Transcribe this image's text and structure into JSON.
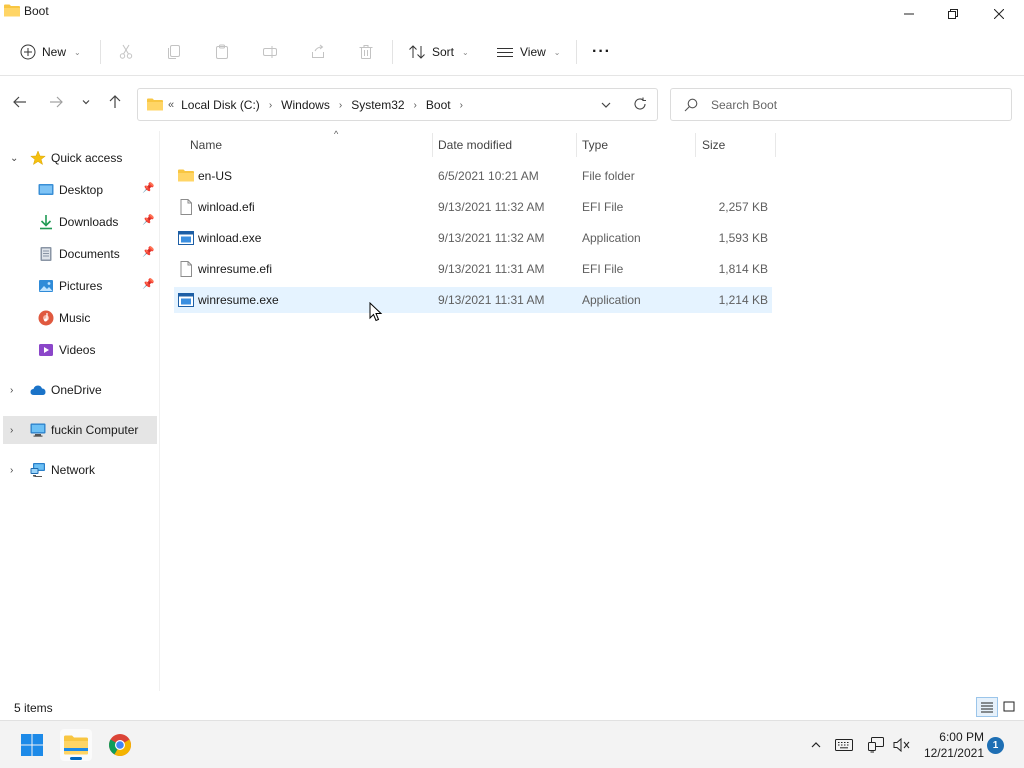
{
  "window": {
    "title": "Boot"
  },
  "commandbar": {
    "new_label": "New",
    "sort_label": "Sort",
    "view_label": "View",
    "more_label": "···"
  },
  "address": {
    "overflow": "«",
    "crumbs": [
      "Local Disk (C:)",
      "Windows",
      "System32",
      "Boot"
    ]
  },
  "search": {
    "placeholder": "Search Boot"
  },
  "sidebar": {
    "items": [
      {
        "label": "Quick access",
        "icon": "star-icon"
      },
      {
        "label": "Desktop",
        "icon": "desktop-icon",
        "pinned": true
      },
      {
        "label": "Downloads",
        "icon": "download-icon",
        "pinned": true
      },
      {
        "label": "Documents",
        "icon": "documents-icon",
        "pinned": true
      },
      {
        "label": "Pictures",
        "icon": "pictures-icon",
        "pinned": true
      },
      {
        "label": "Music",
        "icon": "music-icon"
      },
      {
        "label": "Videos",
        "icon": "videos-icon"
      },
      {
        "label": "OneDrive",
        "icon": "cloud-icon"
      },
      {
        "label": "fuckin Computer",
        "icon": "computer-icon",
        "selected": true
      },
      {
        "label": "Network",
        "icon": "network-icon"
      }
    ]
  },
  "filelist": {
    "columns": {
      "name": "Name",
      "date": "Date modified",
      "type": "Type",
      "size": "Size"
    },
    "rows": [
      {
        "name": "en-US",
        "date": "6/5/2021 10:21 AM",
        "type": "File folder",
        "size": "",
        "icon": "folder-icon"
      },
      {
        "name": "winload.efi",
        "date": "9/13/2021 11:32 AM",
        "type": "EFI File",
        "size": "2,257 KB",
        "icon": "file-icon"
      },
      {
        "name": "winload.exe",
        "date": "9/13/2021 11:32 AM",
        "type": "Application",
        "size": "1,593 KB",
        "icon": "application-icon"
      },
      {
        "name": "winresume.efi",
        "date": "9/13/2021 11:31 AM",
        "type": "EFI File",
        "size": "1,814 KB",
        "icon": "file-icon"
      },
      {
        "name": "winresume.exe",
        "date": "9/13/2021 11:31 AM",
        "type": "Application",
        "size": "1,214 KB",
        "icon": "application-icon",
        "selected": true
      }
    ]
  },
  "status": {
    "item_count": "5 items"
  },
  "taskbar": {
    "time": "6:00 PM",
    "date": "12/21/2021",
    "notification_count": "1"
  },
  "colors": {
    "accent": "#0067c0",
    "folder": "#f8c642",
    "selection": "#e5f3ff"
  }
}
